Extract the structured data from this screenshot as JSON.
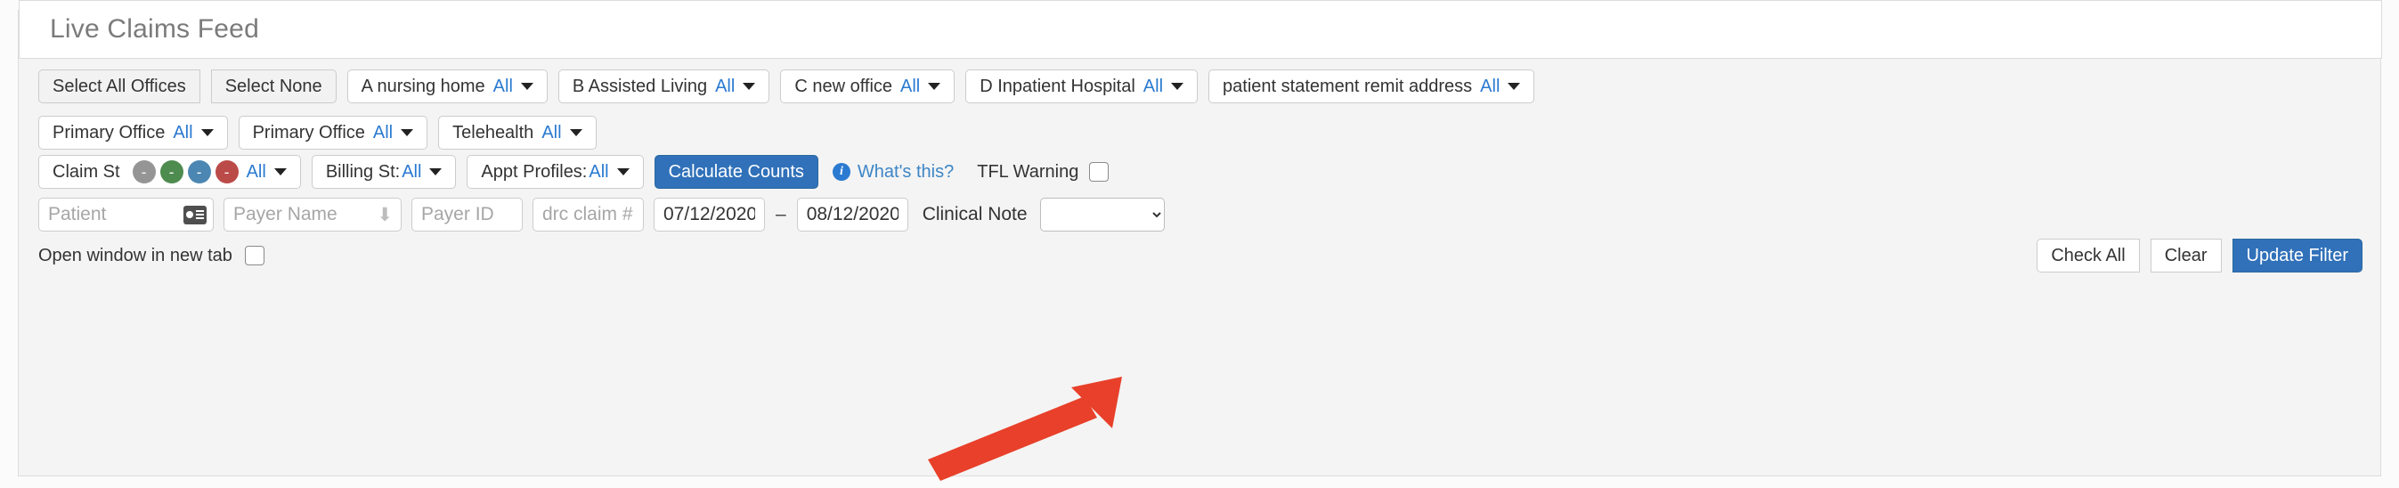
{
  "header": {
    "title": "Live Claims Feed"
  },
  "office_actions": {
    "select_all": "Select All Offices",
    "select_none": "Select None"
  },
  "office_filters_row1": [
    {
      "label": "A nursing home",
      "value": "All",
      "caret_icon": "caret-down-icon"
    },
    {
      "label": "B Assisted Living",
      "value": "All",
      "caret_icon": "caret-down-icon"
    },
    {
      "label": "C new office",
      "value": "All",
      "caret_icon": "caret-down-icon"
    },
    {
      "label": "D Inpatient Hospital",
      "value": "All",
      "caret_icon": "caret-down-icon"
    },
    {
      "label": "patient statement remit address",
      "value": "All",
      "caret_icon": "caret-down-icon"
    }
  ],
  "office_filters_row2": [
    {
      "label": "Primary Office",
      "value": "All",
      "caret_icon": "caret-down-icon"
    },
    {
      "label": "Primary Office",
      "value": "All",
      "caret_icon": "caret-down-icon"
    },
    {
      "label": "Telehealth",
      "value": "All",
      "caret_icon": "caret-down-icon"
    }
  ],
  "status_row": {
    "claim_status_label": "Claim St",
    "claim_status_value": "All",
    "status_dots": [
      {
        "name": "status-dot-gray",
        "glyph": "-",
        "color": "#959595"
      },
      {
        "name": "status-dot-green",
        "glyph": "-",
        "color": "#4d8b4f"
      },
      {
        "name": "status-dot-blue",
        "glyph": "-",
        "color": "#4c87b3"
      },
      {
        "name": "status-dot-red",
        "glyph": "-",
        "color": "#bb4b48"
      }
    ],
    "billing_status": "Billing St: ",
    "billing_status_value": "All",
    "appt_profiles": "Appt Profiles: ",
    "appt_profiles_value": "All",
    "calculate_counts": "Calculate Counts",
    "whats_this": "What's this?",
    "whats_this_icon": "info-circle-icon",
    "tfl_warning_label": "TFL Warning",
    "tfl_warning_checked": false
  },
  "search_row": {
    "patient_placeholder": "Patient",
    "patient_value": "",
    "patient_icon": "id-card-icon",
    "payer_name_placeholder": "Payer Name",
    "payer_name_value": "",
    "payer_name_icon": "arrow-down-icon",
    "payer_id_placeholder": "Payer ID",
    "payer_id_value": "",
    "claim_placeholder": "drc claim #",
    "claim_value": "",
    "date_from": "07/12/2020",
    "date_to": "08/12/2020",
    "date_separator": "–",
    "clinical_note_label": "Clinical Note",
    "clinical_note_value": "",
    "clinical_note_options": [
      ""
    ]
  },
  "bottom_row": {
    "open_new_tab_label": "Open window in new tab",
    "open_new_tab_checked": false,
    "check_all": "Check All",
    "clear": "Clear",
    "update_filter": "Update Filter"
  },
  "annotation": {
    "arrow_color": "#e8402a",
    "points_to": "date_from"
  },
  "colors": {
    "accent_blue": "#3071b9",
    "link_blue": "#2a7ad1",
    "panel_bg": "#f4f4f4",
    "header_bg": "#ffffff"
  }
}
